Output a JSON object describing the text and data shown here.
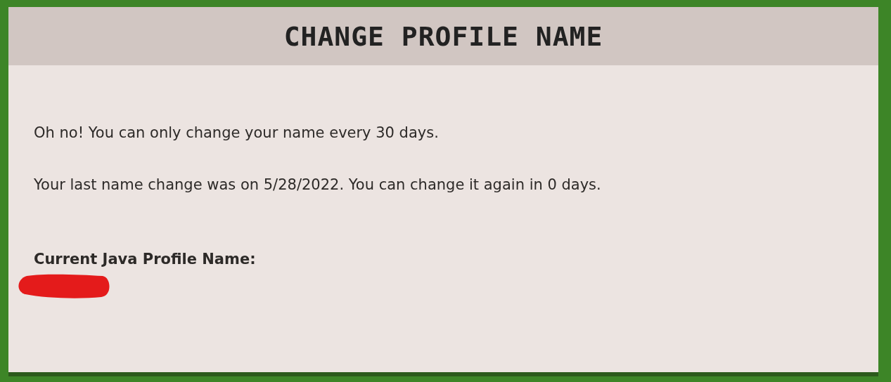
{
  "dialog": {
    "title": "CHANGE PROFILE NAME"
  },
  "messages": [
    "Oh no! You can only change your name every 30 days.",
    "Your last name change was on 5/28/2022. You can change it again in 0 days."
  ],
  "current_name": {
    "label": "Current Java Profile Name:",
    "redacted": true
  }
}
